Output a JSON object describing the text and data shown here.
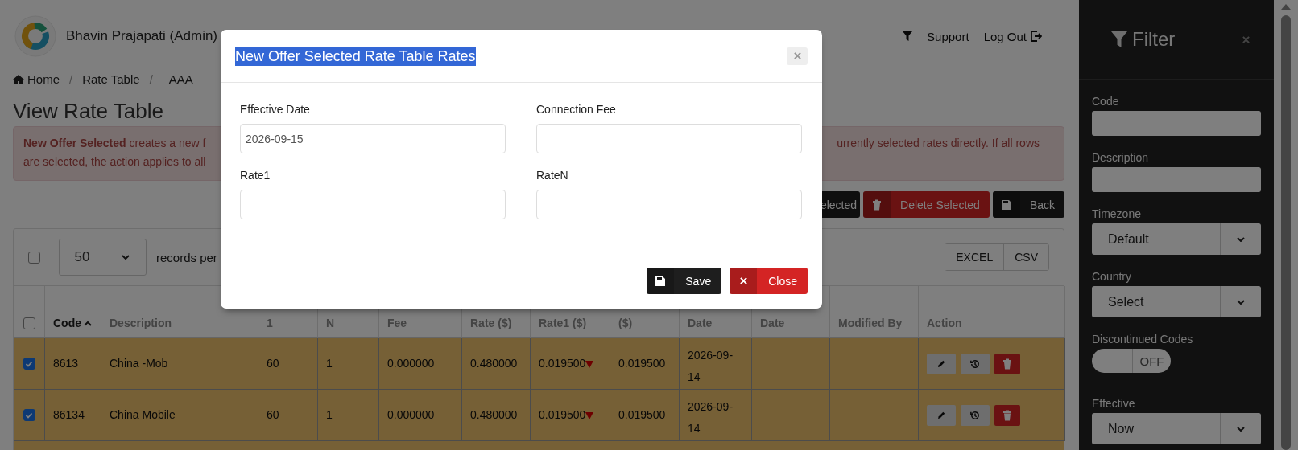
{
  "header": {
    "user": "Bhavin Prajapati (Admin)",
    "links": [
      {
        "label": "Support",
        "kind": "support"
      },
      {
        "label": "Log Out",
        "kind": "logout"
      }
    ]
  },
  "breadcrumb": [
    {
      "label": "Home",
      "kind": "home"
    },
    {
      "label": "Rate Table",
      "kind": "page",
      "separator": "/"
    },
    {
      "label": "AAA",
      "kind": "page",
      "separator": "/"
    }
  ],
  "page_title": "View Rate Table",
  "alert": {
    "left_lines": [
      "**New Offer Selected** creates a new f",
      "are selected, the action applies to all"
    ],
    "right_text": "urrently selected rates directly. If all rows"
  },
  "actions": [
    {
      "label": "elected",
      "kind": "partial"
    },
    {
      "label": "Delete Selected",
      "kind": "delete"
    },
    {
      "label": "Back",
      "kind": "back"
    }
  ],
  "table": {
    "select_all_checked": false,
    "page_size": "50",
    "page_size_label": "records per",
    "export_buttons": [
      "EXCEL",
      "CSV"
    ],
    "header_checked": false,
    "columns": [
      {
        "label": "Code",
        "sorted": true
      },
      {
        "label": "Description",
        "sorted": false
      },
      {
        "label": "1",
        "sorted": false
      },
      {
        "label": "N",
        "sorted": false
      },
      {
        "label": "Fee",
        "sorted": false
      },
      {
        "label": "Rate ($)",
        "sorted": false
      },
      {
        "label": "Rate1 ($)",
        "sorted": false
      },
      {
        "label": "($)",
        "sorted": false
      },
      {
        "label": "Date",
        "sorted": false
      },
      {
        "label": "Date",
        "sorted": false
      },
      {
        "label": "Modified By",
        "sorted": false
      },
      {
        "label": "Action",
        "sorted": false
      }
    ],
    "rows": [
      {
        "selected": true,
        "code": "8613",
        "description": "China -Mob",
        "interval_1": "60",
        "interval_n": "1",
        "fee": "0.000000",
        "rate": "0.480000",
        "rate1": "0.019500",
        "rate1_decreased": true,
        "rate_n": "0.019500",
        "date": "2026-09-14"
      },
      {
        "selected": true,
        "code": "86134",
        "description": "China Mobile",
        "interval_1": "60",
        "interval_n": "1",
        "fee": "0.000000",
        "rate": "0.480000",
        "rate1": "0.019500",
        "rate1_decreased": true,
        "rate_n": "0.019500",
        "date": "2026-09-14"
      },
      {
        "selected": true
      }
    ]
  },
  "filter": {
    "title": "Filter",
    "fields": [
      {
        "label": "Code",
        "kind": "text"
      },
      {
        "label": "Description",
        "kind": "text"
      },
      {
        "label": "Timezone",
        "kind": "select",
        "value": "Default"
      },
      {
        "label": "Country",
        "kind": "select",
        "value": "Select"
      },
      {
        "label": "Discontinued Codes",
        "kind": "toggle",
        "on": false,
        "state_label": "OFF"
      },
      {
        "label": "Effective",
        "kind": "select",
        "value": "Now"
      }
    ]
  },
  "modal": {
    "title": "New Offer Selected Rate Table Rates",
    "title_highlighted": true,
    "fields": [
      {
        "label": "Effective Date",
        "value": "2026-09-15"
      },
      {
        "label": "Connection Fee"
      },
      {
        "label": "Rate1"
      },
      {
        "label": "RateN"
      }
    ],
    "buttons": [
      {
        "label": "Save",
        "kind": "save"
      },
      {
        "label": "Close",
        "kind": "close"
      }
    ]
  }
}
